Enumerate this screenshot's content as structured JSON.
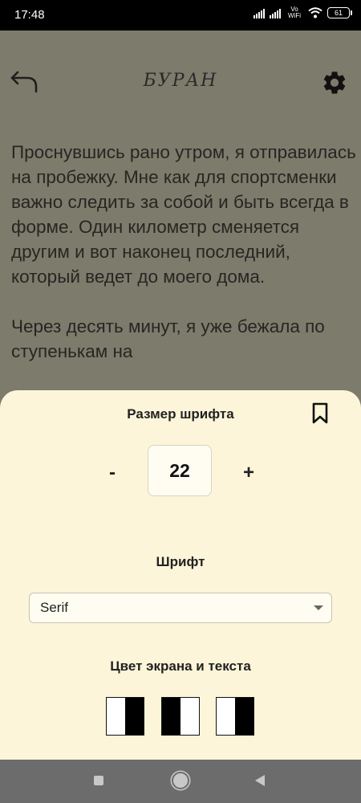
{
  "status_bar": {
    "time": "17:48",
    "vowifi": "Vo WiFi",
    "battery": "61"
  },
  "reader": {
    "title": "БУРАН",
    "back_icon": "back-arrow-icon",
    "settings_icon": "gear-icon",
    "paragraphs": [
      "Проснувшись рано утром, я отправилась на пробежку. Мне как для спортсменки важно следить за собой и быть всегда в форме. Один километр сменяется другим и вот наконец последний, который ведет до моего дома.",
      "Через десять минут, я уже бежала по ступенькам на"
    ]
  },
  "settings_sheet": {
    "font_size_label": "Размер шрифта",
    "bookmark_icon": "bookmark-icon",
    "decrease_label": "-",
    "font_size_value": "22",
    "increase_label": "+",
    "font_label": "Шрифт",
    "font_selected": "Serif",
    "color_label": "Цвет экрана и текста",
    "color_schemes": [
      {
        "left": "#ffffff",
        "right": "#000000"
      },
      {
        "left": "#000000",
        "right": "#ffffff"
      },
      {
        "left": "#ffffff",
        "right": "#000000"
      }
    ]
  },
  "colors": {
    "sheet_background": "#fdf5d9",
    "dimmed_reader_background": "#7d7b6c"
  }
}
